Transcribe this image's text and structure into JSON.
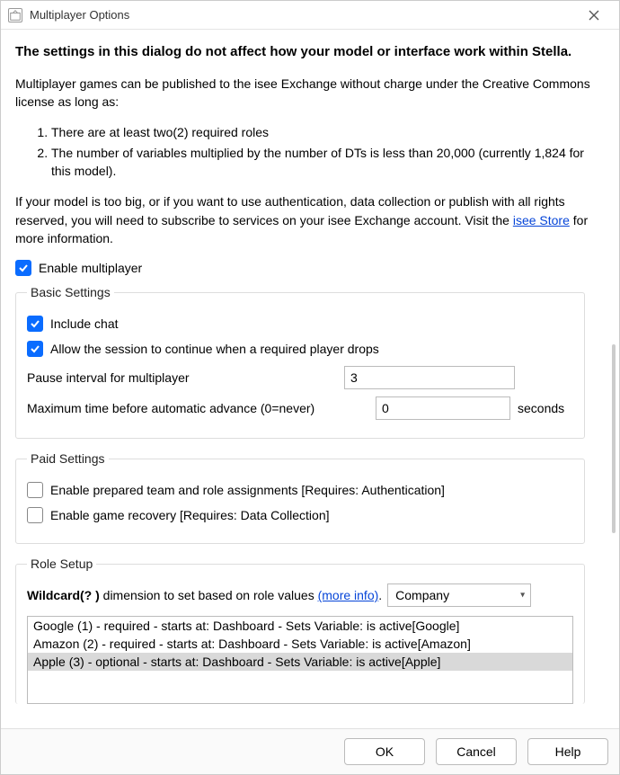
{
  "window": {
    "title": "Multiplayer Options"
  },
  "intro": {
    "bold": "The settings in this dialog do not affect how your model or interface work within Stella.",
    "p1": "Multiplayer games can be published to the isee Exchange without charge under the Creative Commons license as long as:",
    "li1": "There are at least two(2) required roles",
    "li2": "The number of variables multiplied by the number of DTs is less than 20,000 (currently 1,824 for this model).",
    "p2a": "If your model is too big, or if you want to use authentication, data collection or publish with all rights reserved, you will need to subscribe to services on your isee Exchange account. Visit the ",
    "p2link": "isee Store",
    "p2b": " for more information."
  },
  "enable_multiplayer": {
    "label": "Enable multiplayer",
    "checked": true
  },
  "basic": {
    "legend": "Basic Settings",
    "include_chat": {
      "label": "Include chat",
      "checked": true
    },
    "continue_on_drop": {
      "label": "Allow the session to continue when a required player drops",
      "checked": true
    },
    "pause_label": "Pause interval for multiplayer",
    "pause_value": "3",
    "max_label": "Maximum time before automatic advance (0=never)",
    "max_value": "0",
    "max_unit": "seconds"
  },
  "paid": {
    "legend": "Paid Settings",
    "team_assign": {
      "label": "Enable prepared team and role assignments [Requires: Authentication]",
      "checked": false
    },
    "game_recovery": {
      "label": "Enable game recovery [Requires: Data Collection]",
      "checked": false
    }
  },
  "roles": {
    "legend": "Role Setup",
    "wildcard_bold": "Wildcard(? )",
    "wildcard_text": " dimension to set based on role values ",
    "wildcard_link": "(more info)",
    "wildcard_period": ".",
    "dimension_selected": "Company",
    "items": [
      "Google (1) - required - starts at: Dashboard - Sets Variable: is active[Google]",
      "Amazon (2) - required - starts at: Dashboard - Sets Variable: is active[Amazon]",
      "Apple (3) - optional - starts at: Dashboard - Sets Variable: is active[Apple]"
    ],
    "selected_index": 2
  },
  "buttons": {
    "ok": "OK",
    "cancel": "Cancel",
    "help": "Help"
  }
}
